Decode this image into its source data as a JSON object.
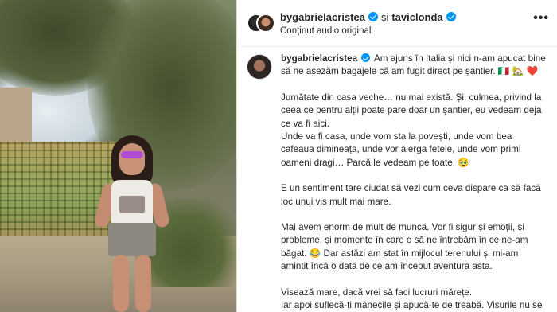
{
  "header": {
    "user1": "bygabrielacristea",
    "and_text": "și",
    "user2": "taviclonda",
    "subtitle": "Conținut audio original",
    "more_label": "•••"
  },
  "caption": {
    "username": "bygabrielacristea",
    "p1": "Am ajuns în Italia și nici n-am apucat bine să ne așezăm bagajele că am fugit direct pe șantier. 🇮🇹 🏡 ❤️",
    "p2": "Jumătate din casa veche… nu mai există. Și, culmea, privind la ceea ce pentru alții poate pare doar un șantier, eu vedeam deja ce va fi aici.",
    "p3": "Unde va fi casa, unde vom sta la povești, unde vom bea cafeaua dimineața, unde vor alerga fetele, unde vom primi oameni dragi… Parcă le vedeam pe toate. 🥹",
    "p4": "E un sentiment tare ciudat să vezi cum ceva dispare ca să facă loc unui vis mult mai mare.",
    "p5": "Mai avem enorm de mult de muncă. Vor fi sigur și emoții, și probleme, și momente în care o să ne întrebăm în ce ne-am băgat. 😂 Dar astăzi am stat în mijlocul terenului și mi-am amintit încă o dată de ce am început aventura asta.",
    "p6a": "Visează mare, dacă vrei să faci lucruri mărețe.",
    "p6b": "Iar apoi suflecă-ți mânecile și apucă-te de treabă. Visurile nu se construiesc singure. ❤️"
  },
  "colors": {
    "verified": "#0095f6",
    "text": "#262626",
    "divider": "#dbdbdb"
  },
  "icons": {
    "verified": "verified-badge-icon",
    "more": "more-options-icon"
  }
}
